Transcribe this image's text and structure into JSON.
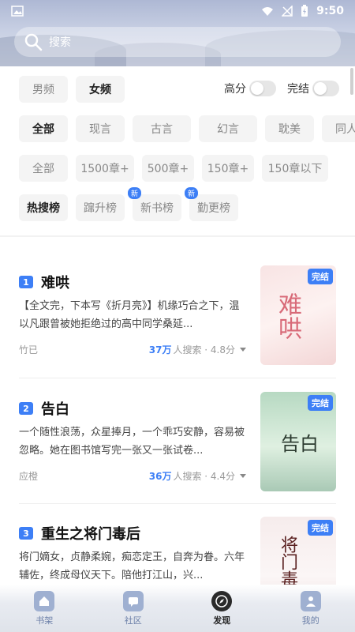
{
  "status_bar": {
    "time": "9:50"
  },
  "search": {
    "placeholder": "搜索"
  },
  "filters": {
    "gender": [
      "男频",
      "女频"
    ],
    "toggles": {
      "high_score": "高分",
      "completed": "完结"
    },
    "genres": [
      "全部",
      "现言",
      "古言",
      "幻言",
      "耽美",
      "同人"
    ],
    "lengths": [
      "全部",
      "1500章+",
      "500章+",
      "150章+",
      "150章以下"
    ],
    "rankings": [
      {
        "label": "热搜榜",
        "badge": ""
      },
      {
        "label": "蹿升榜",
        "badge": ""
      },
      {
        "label": "新书榜",
        "badge": "新"
      },
      {
        "label": "勤更榜",
        "badge": "新"
      }
    ]
  },
  "books": [
    {
      "rank": "1",
      "title": "难哄",
      "description": "【全文完，下本写《折月亮》】机缘巧合之下，温以凡跟曾被她拒绝过的高中同学桑延...",
      "author": "竹已",
      "searches": "37万",
      "search_label": "人搜索 · 4.8分",
      "status": "完结",
      "cover_text": "难哄"
    },
    {
      "rank": "2",
      "title": "告白",
      "description": "一个随性浪荡，众星捧月，一个乖巧安静，容易被忽略。她在图书馆写完一张又一张试卷...",
      "author": "应橙",
      "searches": "36万",
      "search_label": "人搜索 · 4.4分",
      "status": "完结",
      "cover_text": "告白"
    },
    {
      "rank": "3",
      "title": "重生之将门毒后",
      "description": "将门嫡女，贞静柔婉，痴恋定王，自奔为眷。六年辅佐，终成母仪天下。陪他打江山，兴...",
      "author": "",
      "searches": "",
      "search_label": "",
      "status": "完结",
      "cover_text": "将门毒后"
    }
  ],
  "nav": [
    {
      "label": "书架",
      "icon": "home-icon"
    },
    {
      "label": "社区",
      "icon": "chat-icon"
    },
    {
      "label": "发现",
      "icon": "compass-icon"
    },
    {
      "label": "我的",
      "icon": "user-icon"
    }
  ],
  "colors": {
    "accent": "#3d7ff6",
    "header": "#aeb8d4"
  }
}
